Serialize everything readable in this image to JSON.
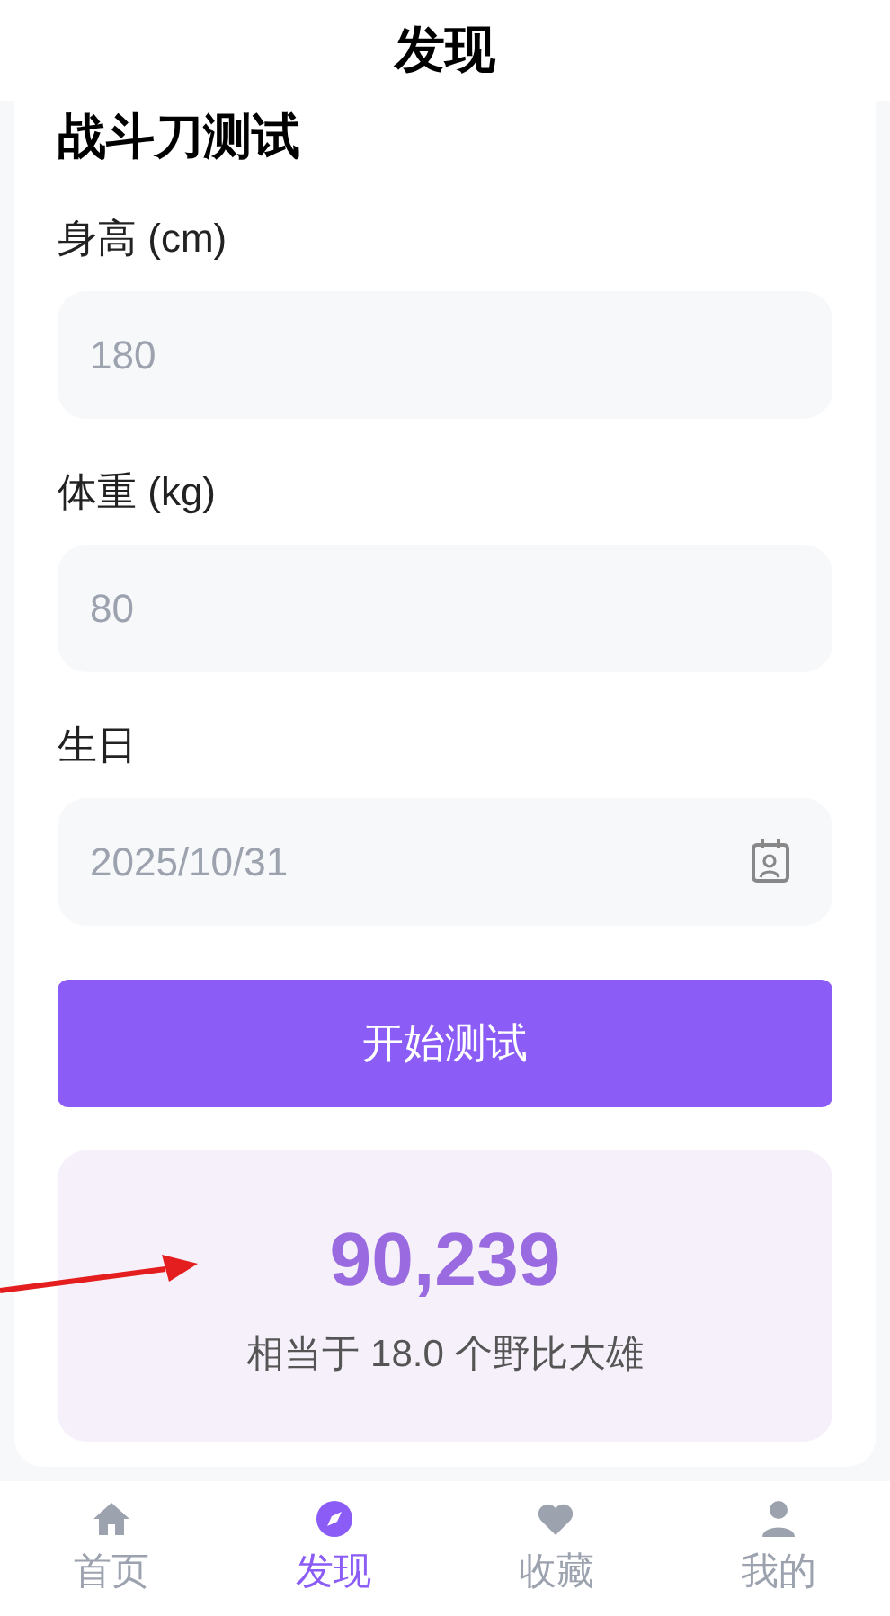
{
  "header": {
    "title": "发现"
  },
  "form": {
    "title": "战斗刀测试",
    "fields": [
      {
        "label": "身高 (cm)",
        "placeholder": "180",
        "kind": "text"
      },
      {
        "label": "体重 (kg)",
        "placeholder": "80",
        "kind": "text"
      },
      {
        "label": "生日",
        "value": "2025/10/31",
        "kind": "date"
      }
    ],
    "submit": "开始测试"
  },
  "result": {
    "value": "90,239",
    "caption": "相当于 18.0 个野比大雄"
  },
  "tabs": [
    {
      "label": "首页",
      "selected": false
    },
    {
      "label": "发现",
      "selected": true
    },
    {
      "label": "收藏",
      "selected": false
    },
    {
      "label": "我的",
      "selected": false
    }
  ]
}
